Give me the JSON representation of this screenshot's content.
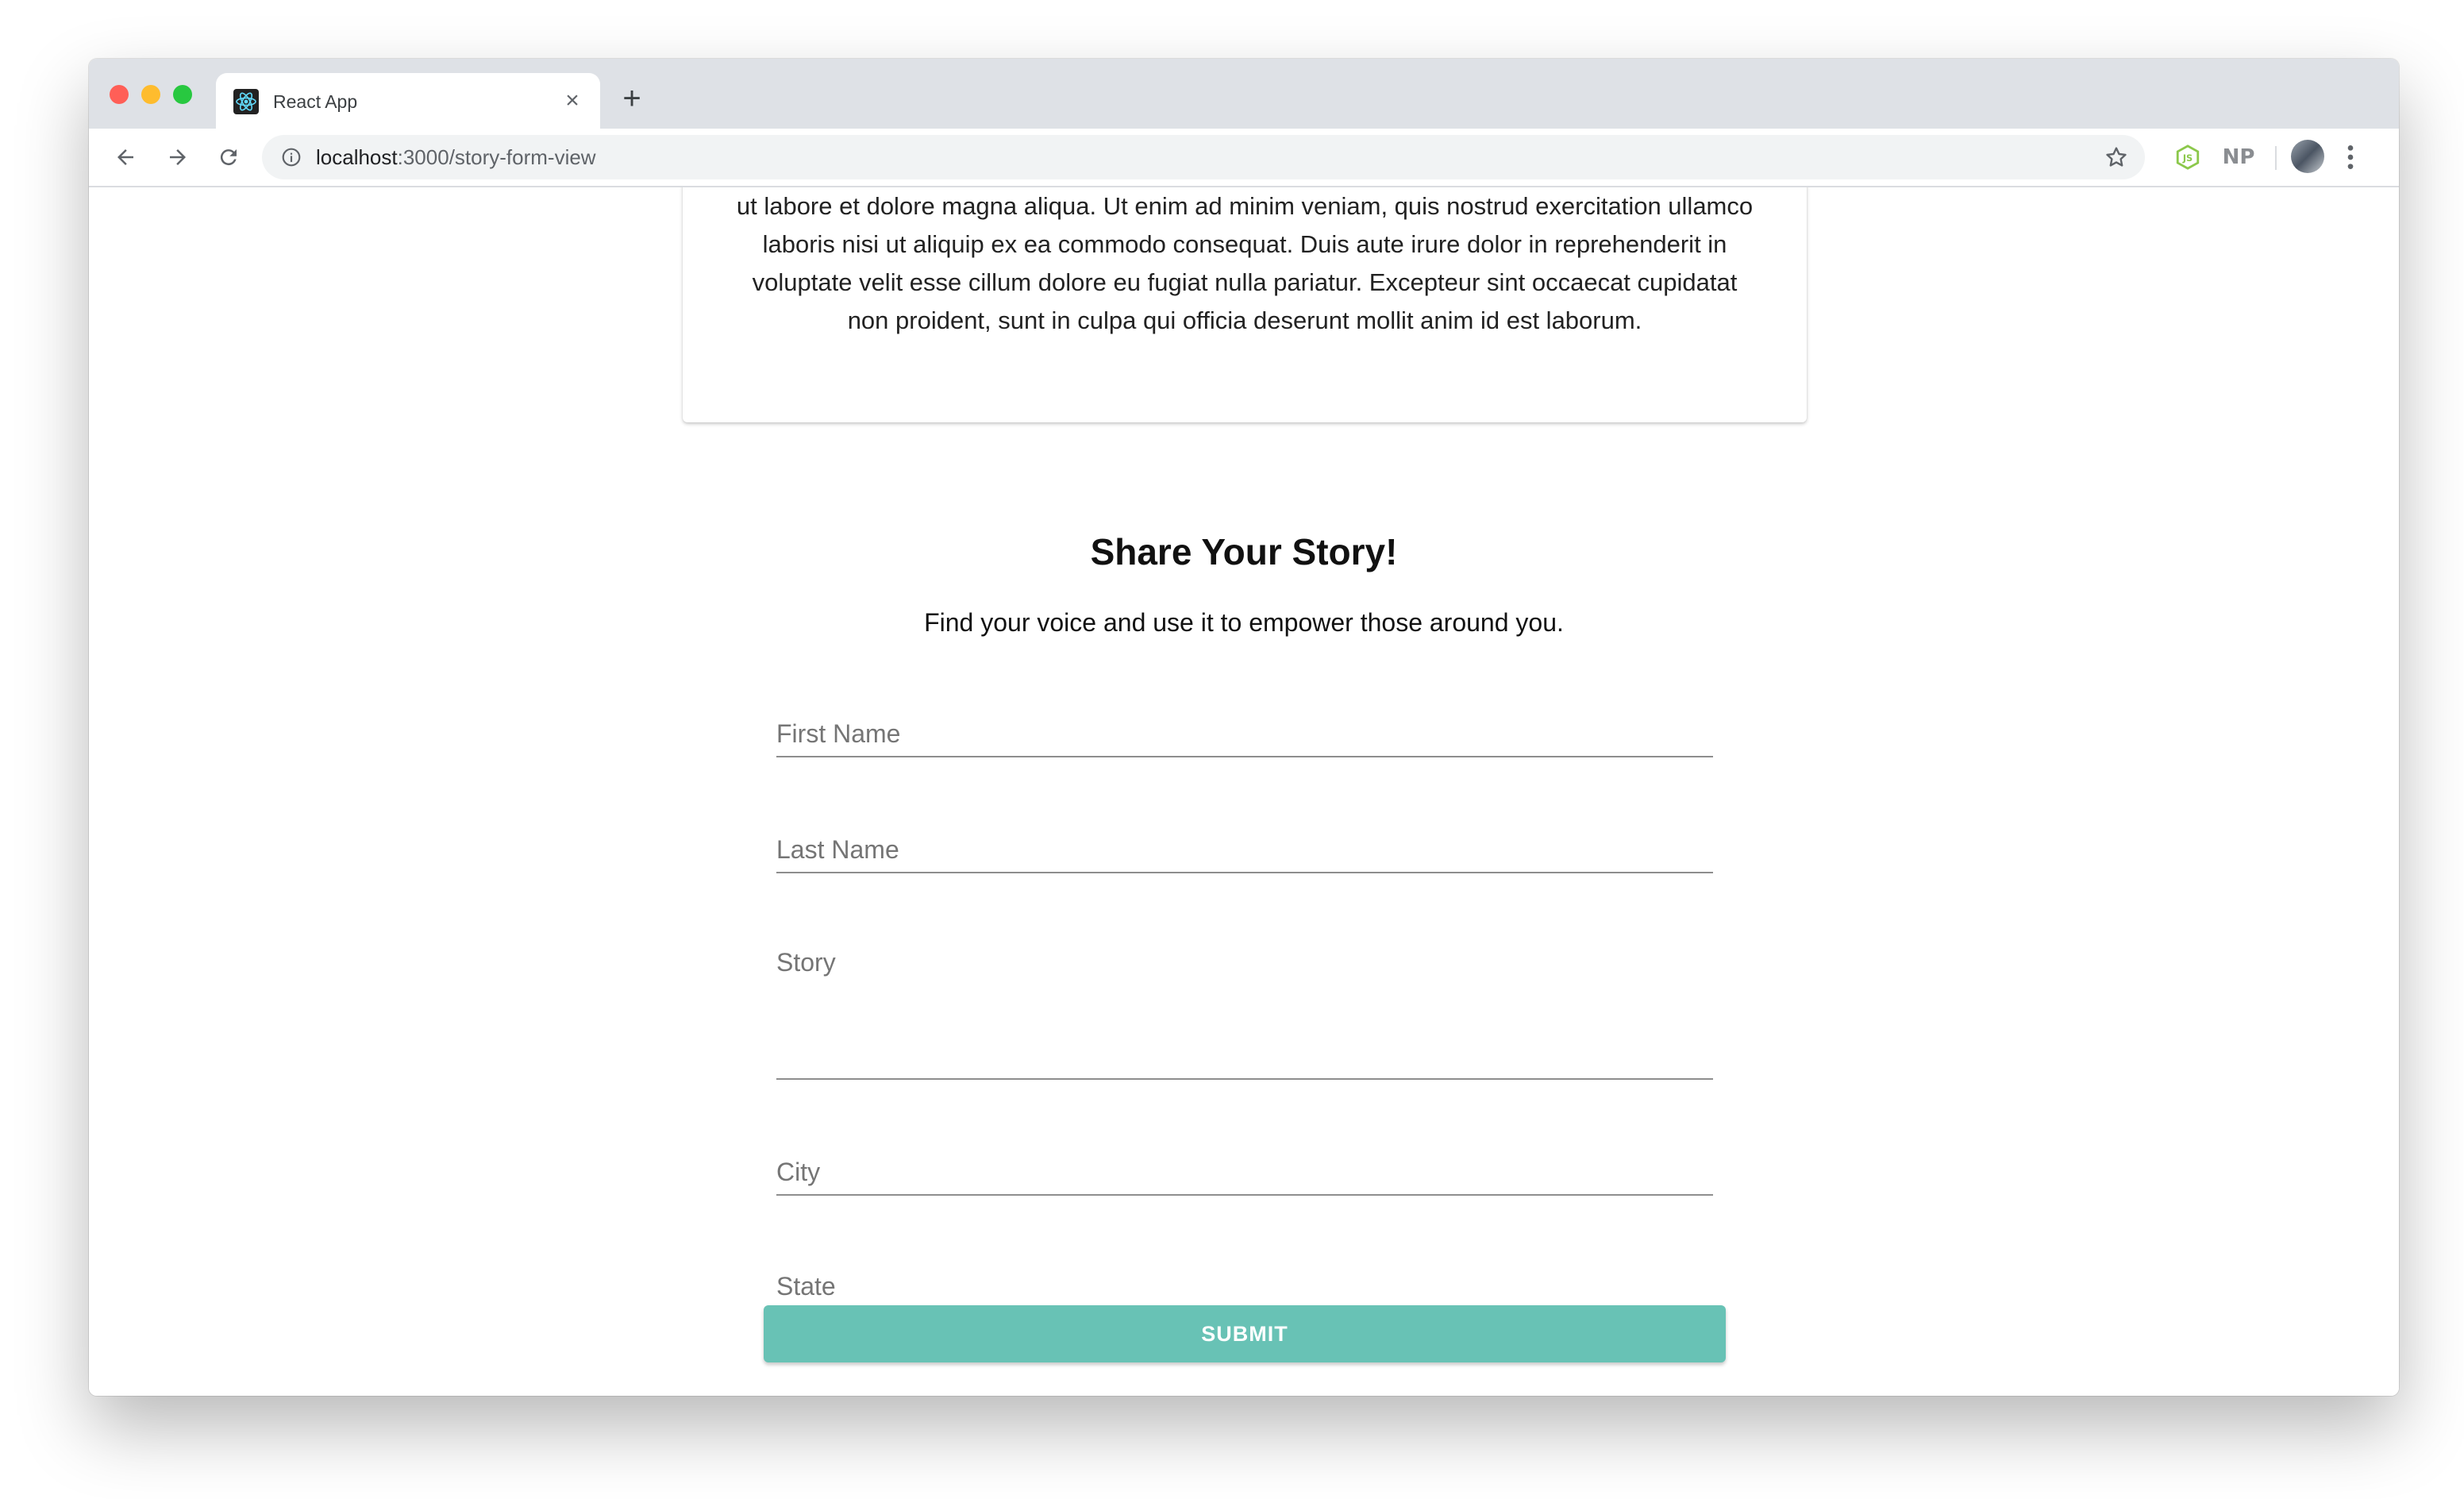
{
  "browser": {
    "tab_title": "React App",
    "url_host": "localhost",
    "url_path": ":3000/story-form-view",
    "extension_label": "NP"
  },
  "page": {
    "card_text": "ut labore et dolore magna aliqua. Ut enim ad minim veniam, quis nostrud exercitation ullamco laboris nisi ut aliquip ex ea commodo consequat. Duis aute irure dolor in reprehenderit in voluptate velit esse cillum dolore eu fugiat nulla pariatur. Excepteur sint occaecat cupidatat non proident, sunt in culpa qui officia deserunt mollit anim id est laborum.",
    "heading": "Share Your Story!",
    "subheading": "Find your voice and use it to empower those around you.",
    "form": {
      "first_name_placeholder": "First Name",
      "last_name_placeholder": "Last Name",
      "story_placeholder": "Story",
      "city_placeholder": "City",
      "state_placeholder": "State",
      "submit_label": "SUBMIT"
    }
  },
  "colors": {
    "accent": "#68c2b5",
    "tabbar": "#dee1e6"
  }
}
